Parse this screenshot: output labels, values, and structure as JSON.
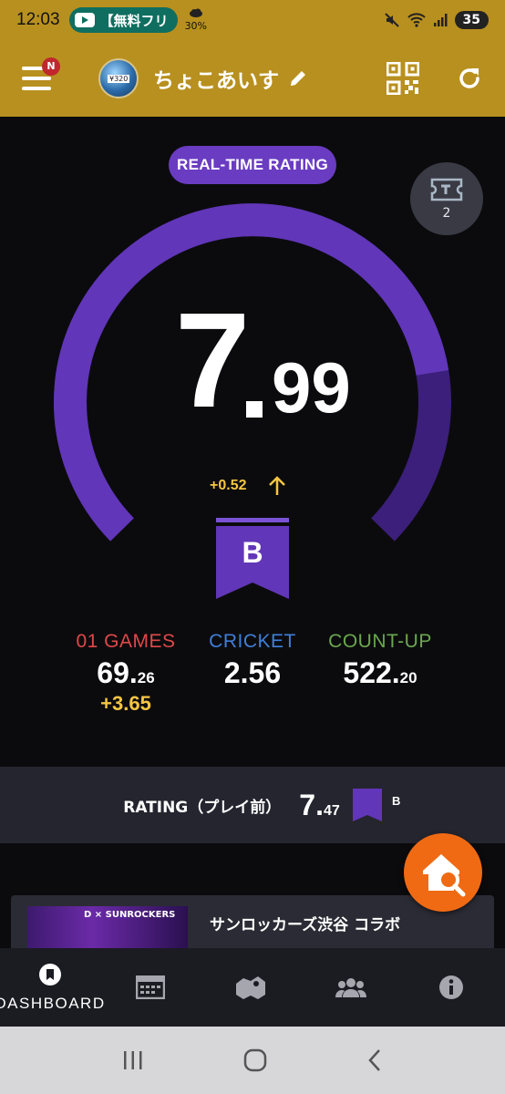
{
  "status_bar": {
    "time": "12:03",
    "notification_app": "【無料フリ",
    "weather": "30%",
    "battery": "35"
  },
  "header": {
    "menu_badge": "N",
    "avatar_tag": "¥320",
    "username": "ちょこあいす",
    "icons": [
      "menu-icon",
      "pencil-icon",
      "qr-code-icon",
      "refresh-icon"
    ]
  },
  "rating_panel": {
    "badge_label": "REAL-TIME RATING",
    "ticket_count": "2",
    "rating_int": "7",
    "rating_dec": "99",
    "delta": "+0.52",
    "class": "B",
    "gauge_fraction": 0.8,
    "accent": "#6a3cc2"
  },
  "stats": {
    "games01": {
      "label": "01 GAMES",
      "int": "69.",
      "dec": "26",
      "delta": "+3.65",
      "color": "#e04848"
    },
    "cricket": {
      "label": "CRICKET",
      "value": "2.56",
      "color": "#3f7fd8"
    },
    "countup": {
      "label": "COUNT-UP",
      "int": "522.",
      "dec": "20",
      "color": "#6aa84f"
    }
  },
  "prev_rating": {
    "label": "RATING（プレイ前）",
    "int": "7.",
    "dec": "47",
    "class": "B"
  },
  "banner": {
    "brand": "D × SUNROCKERS",
    "title": "サンロッカーズ渋谷 コラボ"
  },
  "bottom_nav": {
    "items": [
      {
        "label": "DASHBOARD",
        "icon": "dashboard-icon"
      },
      {
        "icon": "calendar-icon"
      },
      {
        "icon": "map-icon"
      },
      {
        "icon": "friends-icon"
      },
      {
        "icon": "info-icon"
      }
    ]
  },
  "system_nav": {
    "icons": [
      "recents-icon",
      "home-icon",
      "back-icon"
    ]
  }
}
